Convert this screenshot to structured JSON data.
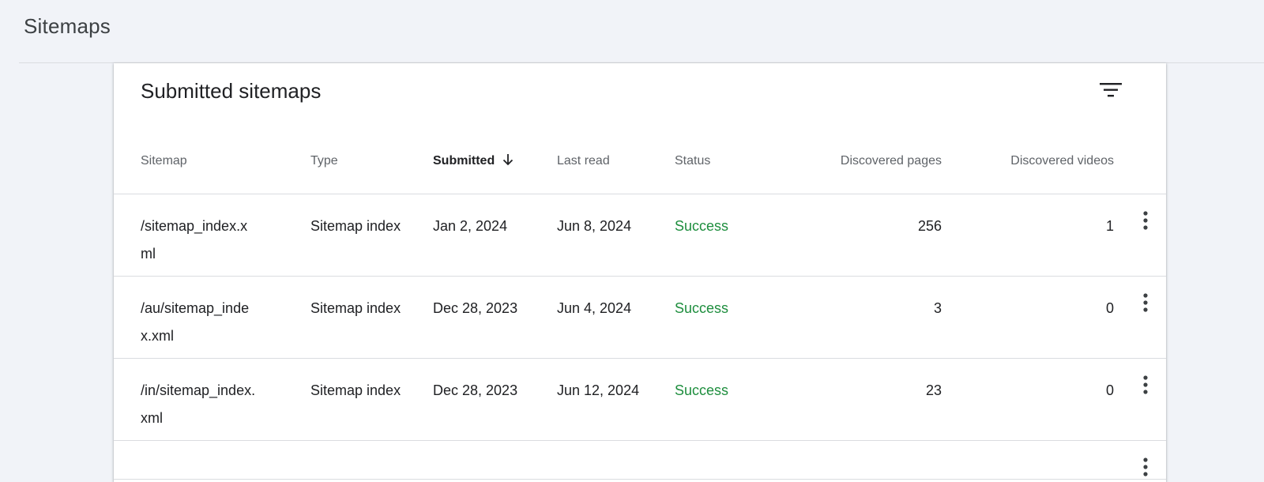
{
  "page": {
    "title": "Sitemaps"
  },
  "card": {
    "title": "Submitted sitemaps",
    "filter_icon": "filter-list-icon"
  },
  "table": {
    "columns": {
      "sitemap": "Sitemap",
      "type": "Type",
      "submitted": "Submitted",
      "last_read": "Last read",
      "status": "Status",
      "discovered_pages": "Discovered pages",
      "discovered_videos": "Discovered videos"
    },
    "sorted_column": "submitted",
    "sort_direction": "descending",
    "rows": [
      {
        "sitemap": "/sitemap_index.xml",
        "type": "Sitemap index",
        "submitted": "Jan 2, 2024",
        "last_read": "Jun 8, 2024",
        "status": "Success",
        "discovered_pages": "256",
        "discovered_videos": "1"
      },
      {
        "sitemap": "/au/sitemap_index.xml",
        "type": "Sitemap index",
        "submitted": "Dec 28, 2023",
        "last_read": "Jun 4, 2024",
        "status": "Success",
        "discovered_pages": "3",
        "discovered_videos": "0"
      },
      {
        "sitemap": "/in/sitemap_index.xml",
        "type": "Sitemap index",
        "submitted": "Dec 28, 2023",
        "last_read": "Jun 12, 2024",
        "status": "Success",
        "discovered_pages": "23",
        "discovered_videos": "0"
      }
    ]
  },
  "colors": {
    "page_bg": "#f1f3f8",
    "card_bg": "#ffffff",
    "success": "#1e8e3e",
    "header_text": "#5f6368",
    "body_text": "#202124",
    "divider": "#dadce0"
  }
}
